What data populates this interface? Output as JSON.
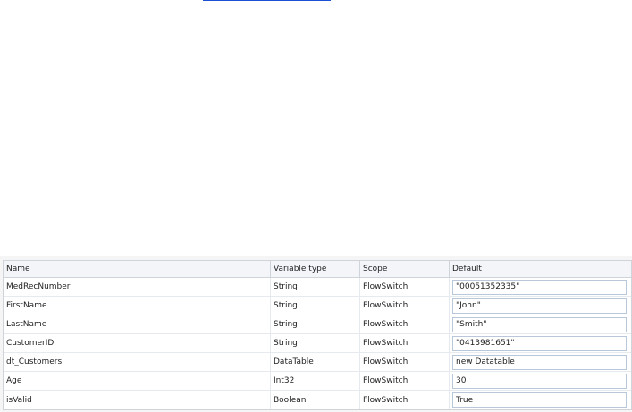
{
  "variables_panel": {
    "columns": [
      "Name",
      "Variable type",
      "Scope",
      "Default"
    ],
    "rows": [
      {
        "name": "MedRecNumber",
        "type": "String",
        "scope": "FlowSwitch",
        "default": "\"00051352335\""
      },
      {
        "name": "FirstName",
        "type": "String",
        "scope": "FlowSwitch",
        "default": "\"John\""
      },
      {
        "name": "LastName",
        "type": "String",
        "scope": "FlowSwitch",
        "default": "\"Smith\""
      },
      {
        "name": "CustomerID",
        "type": "String",
        "scope": "FlowSwitch",
        "default": "\"0413981651\""
      },
      {
        "name": "dt_Customers",
        "type": "DataTable",
        "scope": "FlowSwitch",
        "default": "new Datatable"
      },
      {
        "name": "Age",
        "type": "Int32",
        "scope": "FlowSwitch",
        "default": "30"
      },
      {
        "name": "isValid",
        "type": "Boolean",
        "scope": "FlowSwitch",
        "default": "True"
      }
    ]
  },
  "colors": {
    "link_line": "#1a4fd6",
    "grid_border": "#cfd3da",
    "input_border": "#b9c7da"
  }
}
